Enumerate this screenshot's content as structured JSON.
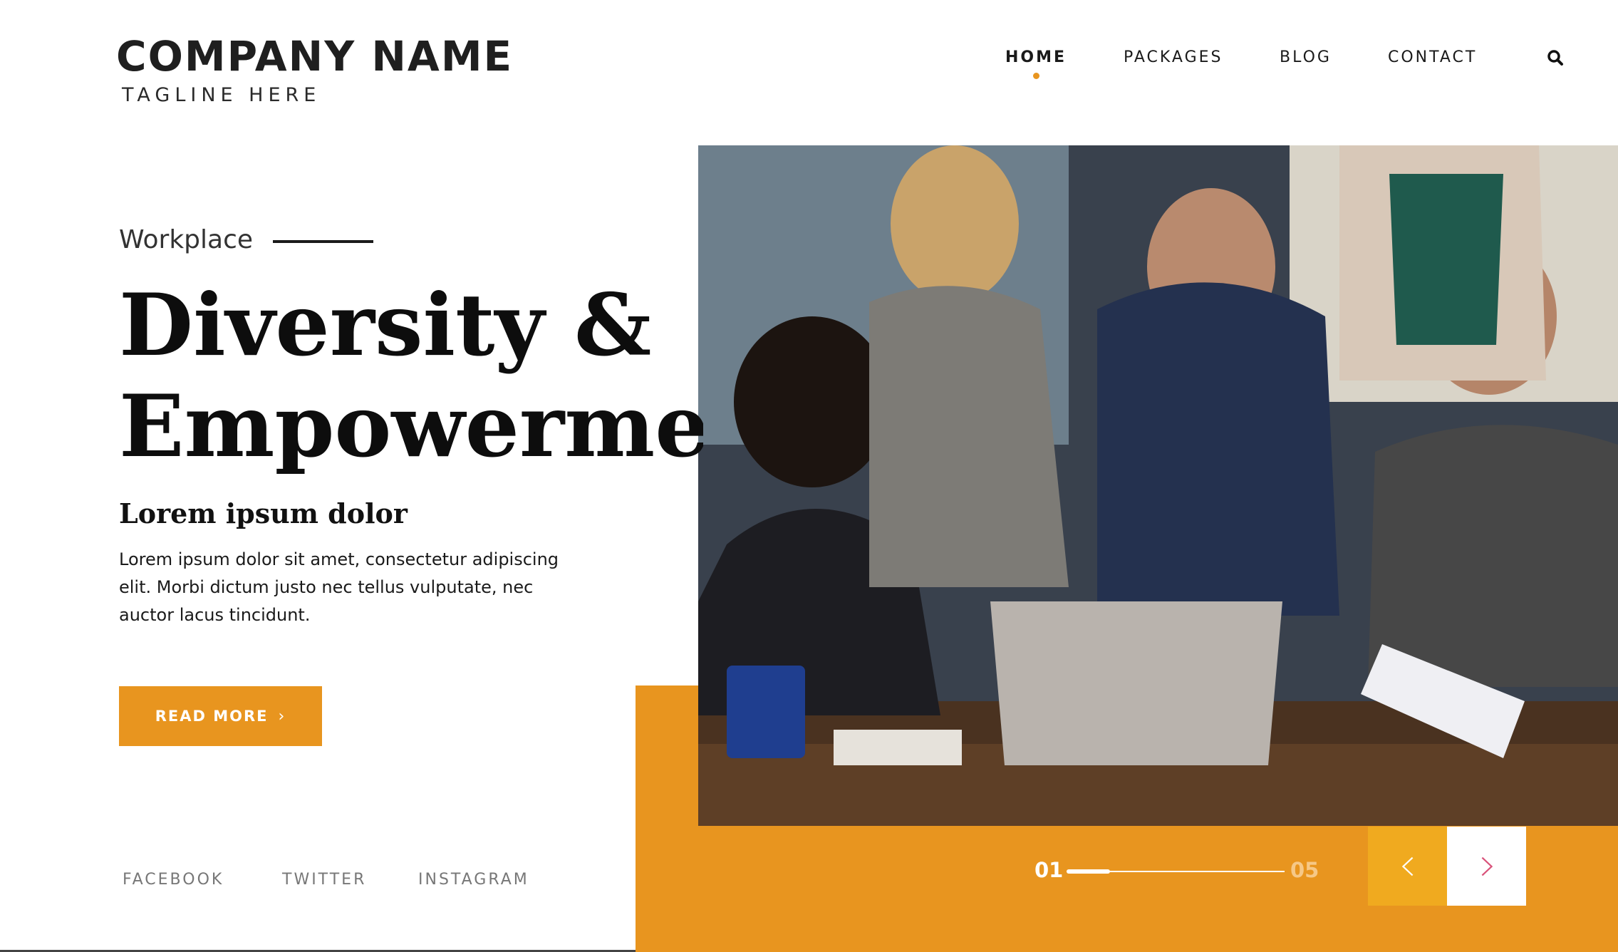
{
  "brand": {
    "name": "COMPANY NAME",
    "tagline": "TAGLINE HERE"
  },
  "nav": {
    "items": [
      {
        "label": "HOME",
        "active": true
      },
      {
        "label": "PACKAGES",
        "active": false
      },
      {
        "label": "BLOG",
        "active": false
      },
      {
        "label": "CONTACT",
        "active": false
      }
    ],
    "search_icon": "search-icon"
  },
  "hero": {
    "eyebrow": "Workplace",
    "headline_line1": "Diversity &",
    "headline_line2": "Empowermen",
    "subheading": "Lorem ipsum dolor",
    "body": "Lorem ipsum dolor sit amet, consectetur adipiscing elit. Morbi dictum justo nec tellus vulputate, nec auctor lacus tincidunt.",
    "cta_label": "READ MORE",
    "image_alt": "Team meeting around a laptop"
  },
  "social": {
    "facebook": "FACEBOOK",
    "twitter": "TWITTER",
    "instagram": "INSTAGRAM"
  },
  "pager": {
    "current": "01",
    "total": "05",
    "progress_fraction": 0.2
  },
  "colors": {
    "accent": "#e8951f",
    "accent_light": "#f0aa1f",
    "text": "#111111",
    "next_arrow": "#d9527a"
  }
}
